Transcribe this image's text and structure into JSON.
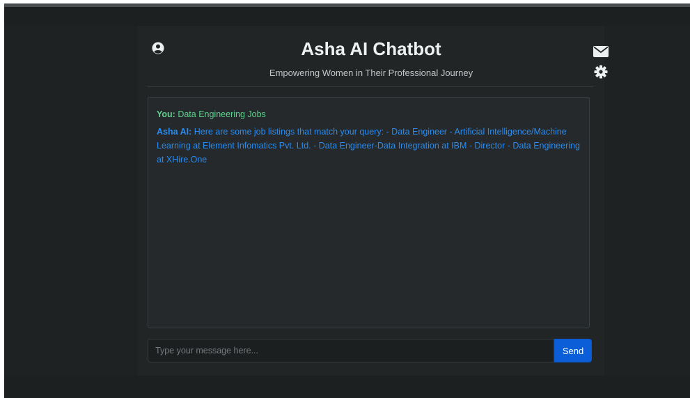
{
  "header": {
    "title": "Asha AI Chatbot",
    "subtitle": "Empowering Women in Their Professional Journey",
    "icons": [
      "user-circle-icon",
      "mail-icon",
      "gear-icon"
    ]
  },
  "chat": {
    "messages": [
      {
        "speaker": "You:",
        "text": " Data Engineering Jobs",
        "color": "#5fd08d"
      },
      {
        "speaker": "Asha AI:",
        "text": " Here are some job listings that match your query: - Data Engineer - Artificial Intelligence/Machine Learning at Element Infomatics Pvt. Ltd. - Data Engineer-Data Integration at IBM - Director - Data Engineering at XHire.One",
        "color": "#2a8cf0"
      }
    ]
  },
  "composer": {
    "placeholder": "Type your message here...",
    "value": "",
    "send_label": "Send"
  },
  "colors": {
    "background": "#1d2021",
    "accent": "#0b5ed7"
  }
}
